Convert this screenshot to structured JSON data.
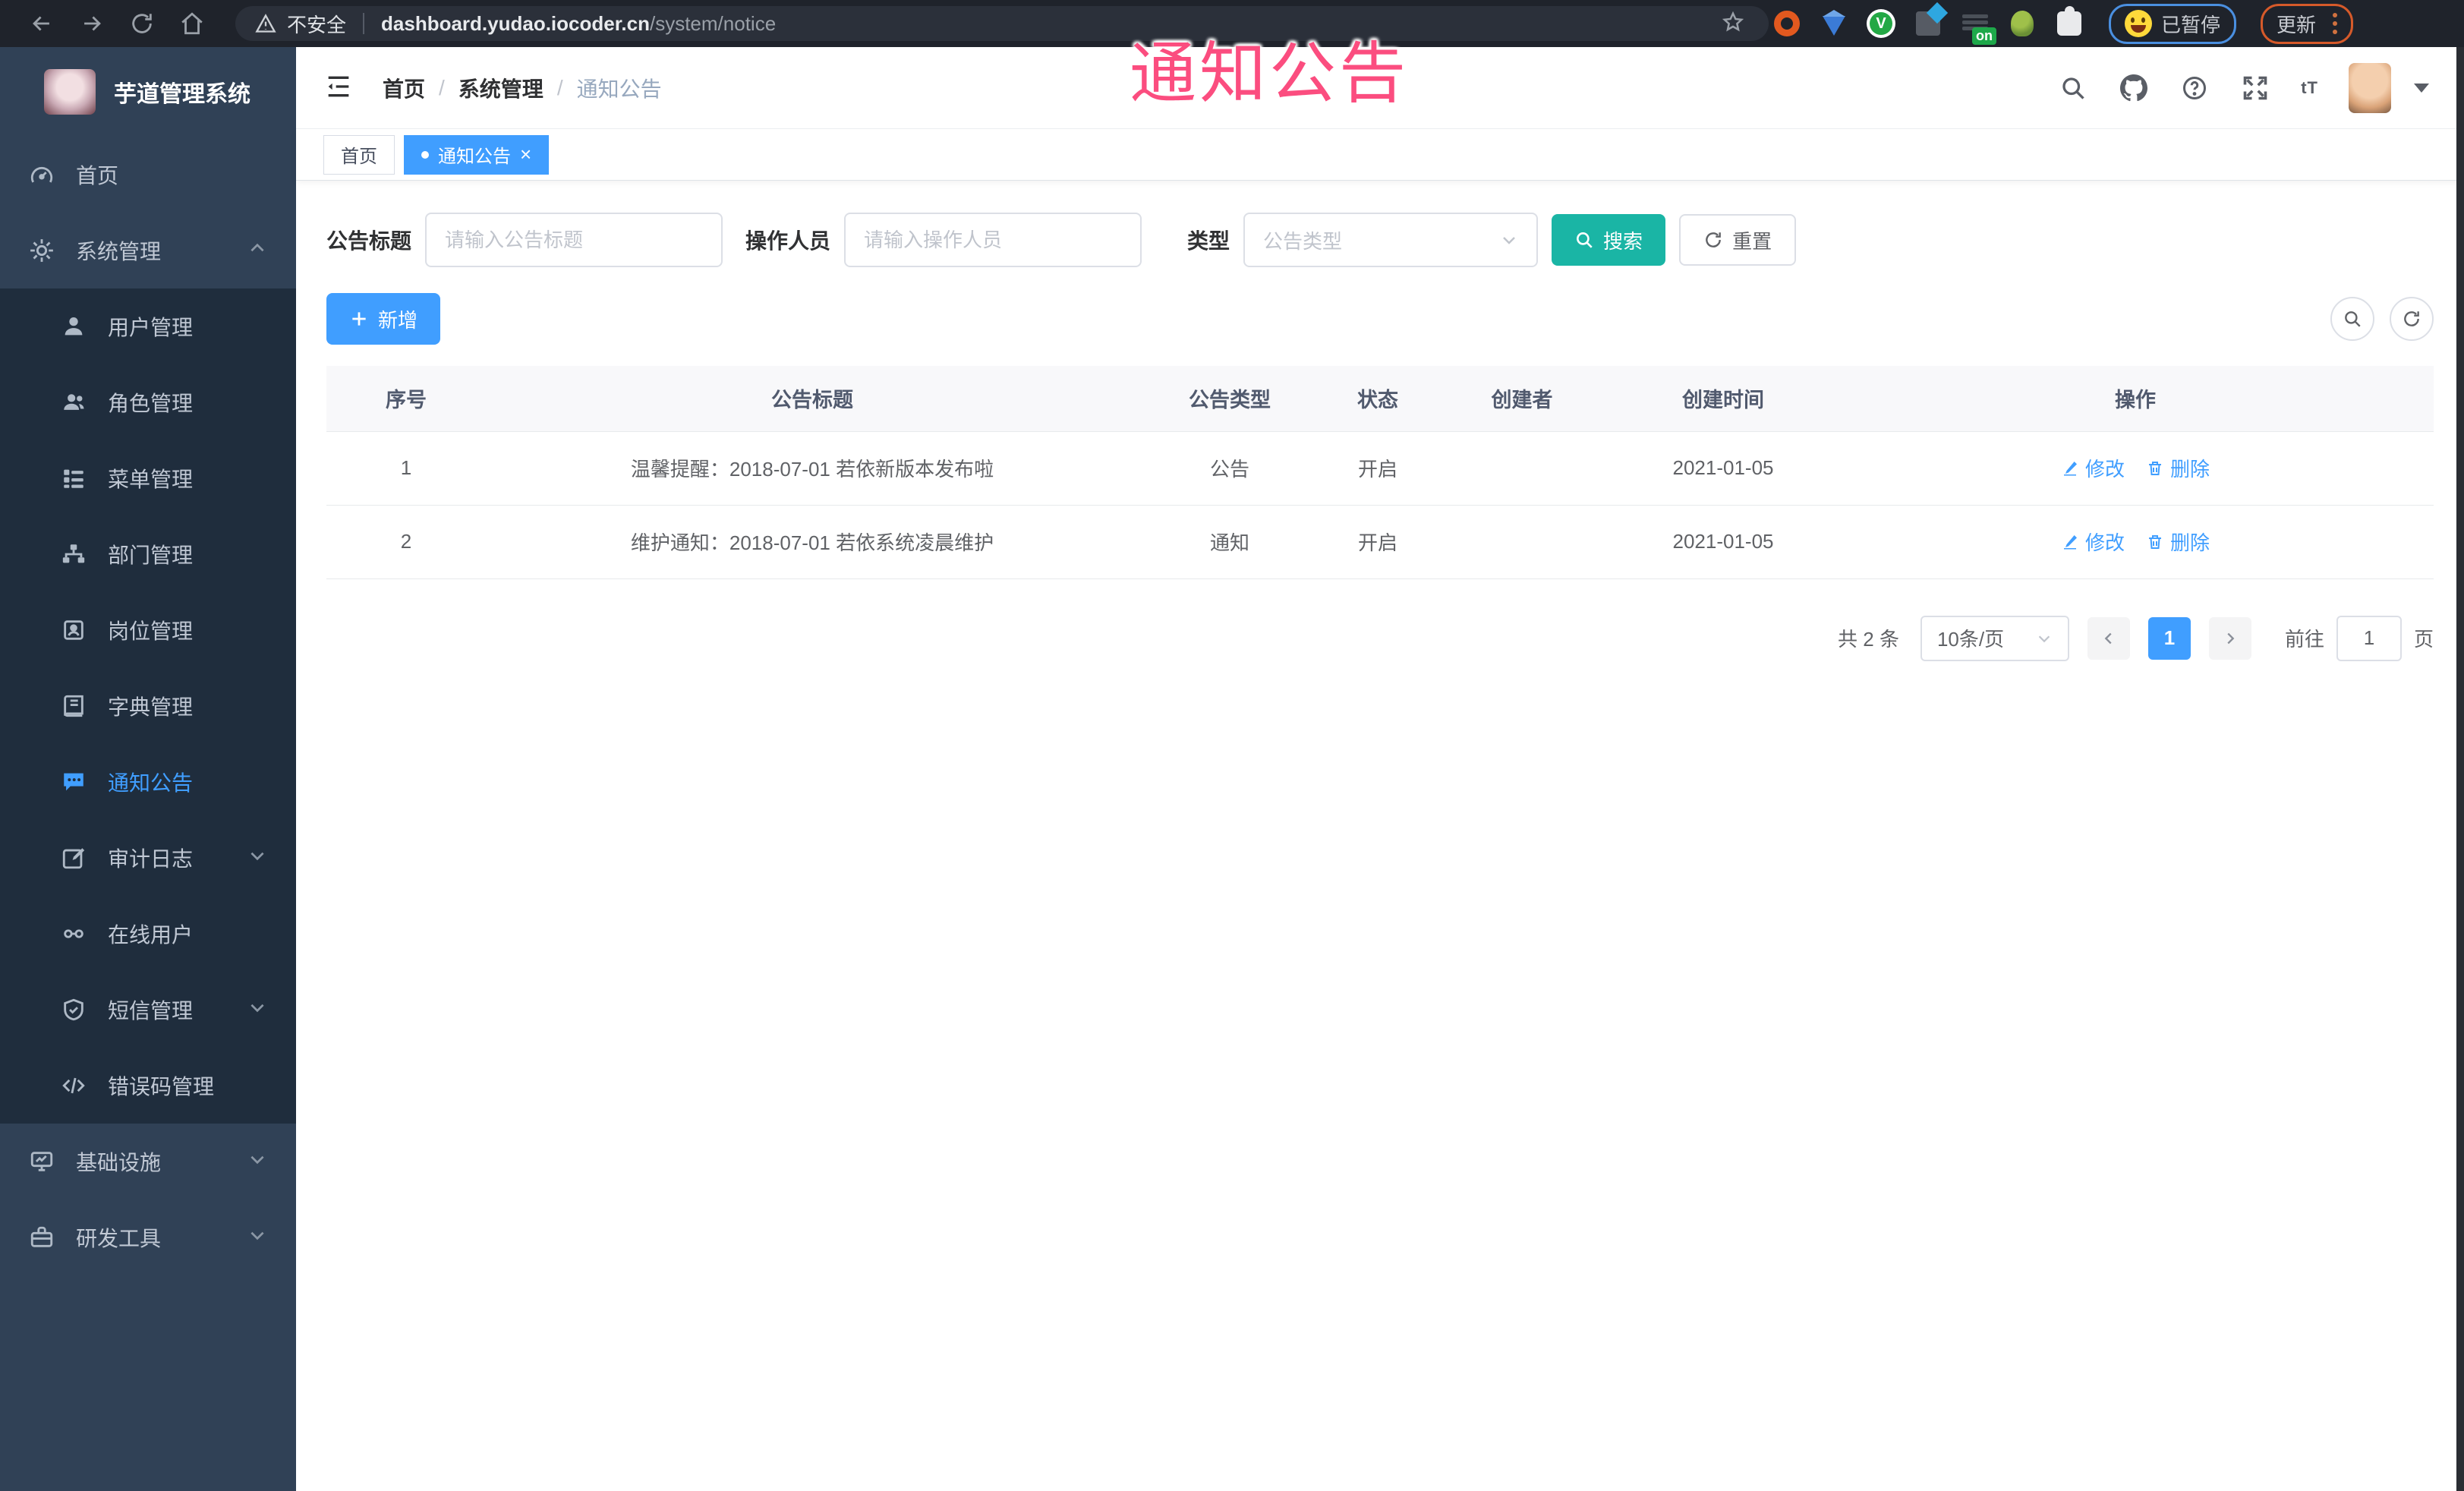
{
  "browser": {
    "security_warning": "不安全",
    "url_domain": "dashboard.yudao.iocoder.cn",
    "url_path": "/system/notice",
    "extension_on_badge": "on",
    "paused_badge": "已暂停",
    "update_button": "更新"
  },
  "watermark": "通知公告",
  "sidebar": {
    "title": "芋道管理系统",
    "home": "首页",
    "system": "系统管理",
    "sub": [
      "用户管理",
      "角色管理",
      "菜单管理",
      "部门管理",
      "岗位管理",
      "字典管理",
      "通知公告",
      "审计日志",
      "在线用户",
      "短信管理",
      "错误码管理"
    ],
    "infra": "基础设施",
    "devtools": "研发工具"
  },
  "header": {
    "breadcrumb": [
      "首页",
      "系统管理",
      "通知公告"
    ],
    "font_icon": "tT"
  },
  "tabs": {
    "home": "首页",
    "notice": "通知公告"
  },
  "filters": {
    "title_label": "公告标题",
    "title_placeholder": "请输入公告标题",
    "operator_label": "操作人员",
    "operator_placeholder": "请输入操作人员",
    "type_label": "类型",
    "type_placeholder": "公告类型",
    "search_label": "搜索",
    "reset_label": "重置"
  },
  "toolbar": {
    "add_label": "新增"
  },
  "table": {
    "columns": [
      "序号",
      "公告标题",
      "公告类型",
      "状态",
      "创建者",
      "创建时间",
      "操作"
    ],
    "rows": [
      {
        "index": "1",
        "title": "温馨提醒：2018-07-01 若依新版本发布啦",
        "type": "公告",
        "status": "开启",
        "creator": "",
        "created": "2021-01-05"
      },
      {
        "index": "2",
        "title": "维护通知：2018-07-01 若依系统凌晨维护",
        "type": "通知",
        "status": "开启",
        "creator": "",
        "created": "2021-01-05"
      }
    ],
    "edit_label": "修改",
    "delete_label": "删除"
  },
  "pagination": {
    "total": "共 2 条",
    "page_size": "10条/页",
    "current": "1",
    "goto_label": "前往",
    "goto_value": "1",
    "page_label": "页"
  },
  "colors": {
    "primary": "#409eff",
    "teal": "#1ab5a5",
    "pink": "#fb4d7f",
    "sidebar": "#304156",
    "submenu": "#1f2d3d"
  }
}
